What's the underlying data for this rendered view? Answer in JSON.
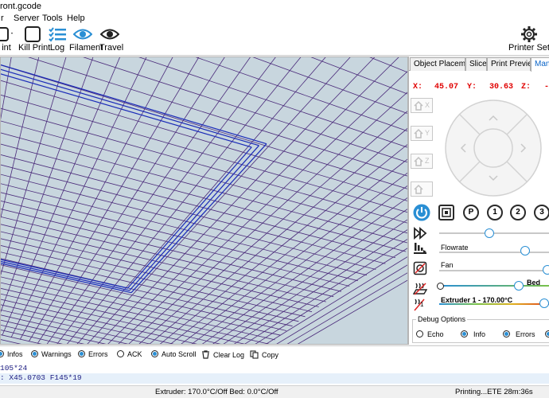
{
  "window": {
    "title": "ront.gcode"
  },
  "menu": {
    "items": [
      "r",
      "Server",
      "Tools",
      "Help"
    ]
  },
  "toolbar": {
    "print_label": "int",
    "kill_print_label": "Kill Print",
    "log_label": "Log",
    "filament_label": "Filament",
    "travel_label": "Travel",
    "printer_settings_label": "Printer Setting"
  },
  "tabs": [
    {
      "label": "Object Placement",
      "active": false
    },
    {
      "label": "Slicer",
      "active": false
    },
    {
      "label": "Print Preview",
      "active": false
    },
    {
      "label": "Manu",
      "active": true
    }
  ],
  "position": {
    "x_label": "X:",
    "x_value": "45.07",
    "y_label": "Y:",
    "y_value": "30.63",
    "z_label": "Z:",
    "z_value": "-("
  },
  "home_buttons": [
    "X",
    "Y",
    "Z",
    ""
  ],
  "quick_buttons": [
    "P",
    "1",
    "2",
    "3"
  ],
  "controls": {
    "flowrate_label": "Flowrate",
    "fan_label": "Fan",
    "bed_label": "Bed",
    "extruder_label": "Extruder 1 - 170.00°C",
    "extruder_index": "1",
    "sliders": {
      "speed": 0.45,
      "flowrate": 0.78,
      "fan": 0.98,
      "bed": 0.72,
      "extruder": 0.95
    }
  },
  "debug": {
    "legend": "Debug Options",
    "options": [
      {
        "label": "Echo",
        "checked": false
      },
      {
        "label": "Info",
        "checked": true
      },
      {
        "label": "Errors",
        "checked": true
      }
    ]
  },
  "log_options": [
    {
      "label": "Infos",
      "checked": true
    },
    {
      "label": "Warnings",
      "checked": true
    },
    {
      "label": "Errors",
      "checked": true
    },
    {
      "label": "ACK",
      "checked": false
    },
    {
      "label": "Auto Scroll",
      "checked": true
    },
    {
      "label": "Clear Log"
    },
    {
      "label": "Copy"
    }
  ],
  "log_lines": [
    "105*24",
    ": X45.0703 F145*19"
  ],
  "status": {
    "temps": "Extruder: 170.0°C/Off Bed: 0.0°C/Off",
    "progress": "Printing...ETE 28m:36s"
  },
  "colors": {
    "accent": "#2a8fd4",
    "coords": "#e00000",
    "grid": "#4a2a7a",
    "toolpath": "#1a2ab8",
    "viewport_bg": "#c8d6de"
  }
}
